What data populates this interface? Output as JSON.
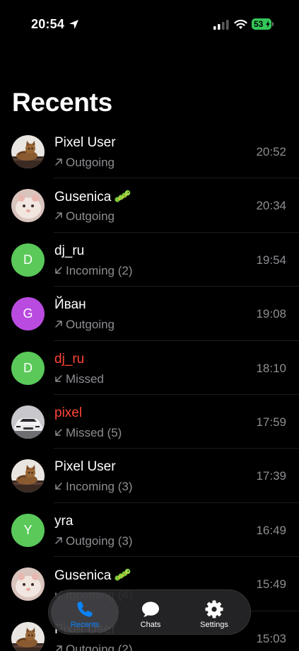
{
  "status_bar": {
    "time": "20:54",
    "battery": "53"
  },
  "page": {
    "title": "Recents"
  },
  "calls": [
    {
      "name": "Pixel User",
      "detail": "Outgoing",
      "direction": "outgoing",
      "time": "20:52",
      "missed": false,
      "avatar": "cat-photo"
    },
    {
      "name": "Gusenica",
      "detail": "Outgoing",
      "direction": "outgoing",
      "time": "20:34",
      "missed": false,
      "avatar": "hamster-photo",
      "emoji": "caterpillar-emoji"
    },
    {
      "name": "dj_ru",
      "detail": "Incoming (2)",
      "direction": "incoming",
      "time": "19:54",
      "missed": false,
      "avatar": "letter",
      "initial": "D",
      "avatar_color": "#5ac95a"
    },
    {
      "name": "Йван",
      "detail": "Outgoing",
      "direction": "outgoing",
      "time": "19:08",
      "missed": false,
      "avatar": "letter",
      "initial": "G",
      "avatar_color": "#b94be0"
    },
    {
      "name": "dj_ru",
      "detail": "Missed",
      "direction": "incoming",
      "time": "18:10",
      "missed": true,
      "avatar": "letter",
      "initial": "D",
      "avatar_color": "#5ac95a"
    },
    {
      "name": "pixel",
      "detail": "Missed (5)",
      "direction": "incoming",
      "time": "17:59",
      "missed": true,
      "avatar": "car-photo"
    },
    {
      "name": "Pixel User",
      "detail": "Incoming (3)",
      "direction": "incoming",
      "time": "17:39",
      "missed": false,
      "avatar": "cat-photo"
    },
    {
      "name": "yra",
      "detail": "Outgoing (3)",
      "direction": "outgoing",
      "time": "16:49",
      "missed": false,
      "avatar": "letter",
      "initial": "Y",
      "avatar_color": "#5ac95a"
    },
    {
      "name": "Gusenica",
      "detail": "Incoming (4)",
      "direction": "incoming",
      "time": "15:49",
      "missed": false,
      "avatar": "hamster-photo",
      "emoji": "caterpillar-emoji"
    },
    {
      "name": "Pixel User",
      "detail": "Outgoing (2)",
      "direction": "outgoing",
      "time": "15:03",
      "missed": false,
      "avatar": "cat-photo"
    }
  ],
  "tab_bar": {
    "tabs": [
      {
        "label": "Recents",
        "icon": "phone-icon",
        "active": true
      },
      {
        "label": "Chats",
        "icon": "chat-bubble-icon",
        "active": false
      },
      {
        "label": "Settings",
        "icon": "gear-icon",
        "active": false
      }
    ]
  },
  "colors": {
    "accent": "#0a84ff",
    "missed": "#ff453a",
    "secondary_text": "#8e8e93",
    "battery": "#34c759"
  }
}
